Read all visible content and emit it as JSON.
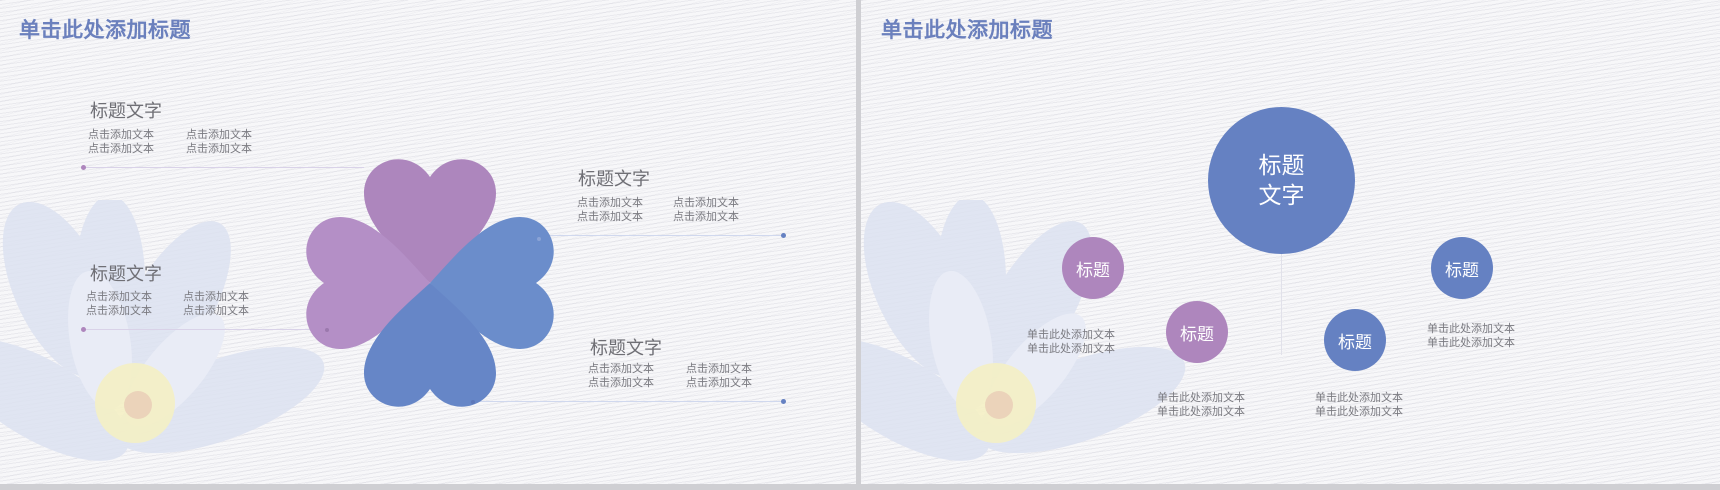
{
  "colors": {
    "title_blue": "#6b80bd",
    "purple": "#ae86bd",
    "blue": "#6581c2",
    "background": "#f7f7f9"
  },
  "left_slide": {
    "title": "单击此处添加标题",
    "blocks": [
      {
        "heading": "标题文字",
        "col1": "点击添加文本\n点击添加文本",
        "col2": "点击添加文本\n点击添加文本"
      },
      {
        "heading": "标题文字",
        "col1": "点击添加文本\n点击添加文本",
        "col2": "点击添加文本\n点击添加文本"
      },
      {
        "heading": "标题文字",
        "col1": "点击添加文本\n点击添加文本",
        "col2": "点击添加文本\n点击添加文本"
      },
      {
        "heading": "标题文字",
        "col1": "点击添加文本\n点击添加文本",
        "col2": "点击添加文本\n点击添加文本"
      }
    ]
  },
  "right_slide": {
    "title": "单击此处添加标题",
    "center_bubble": "标题\n文字",
    "bubbles": [
      {
        "label": "标题",
        "caption": "单击此处添加文本\n单击此处添加文本"
      },
      {
        "label": "标题",
        "caption": "单击此处添加文本\n单击此处添加文本"
      },
      {
        "label": "标题",
        "caption": "单击此处添加文本\n单击此处添加文本"
      },
      {
        "label": "标题",
        "caption": "单击此处添加文本\n单击此处添加文本"
      }
    ]
  }
}
